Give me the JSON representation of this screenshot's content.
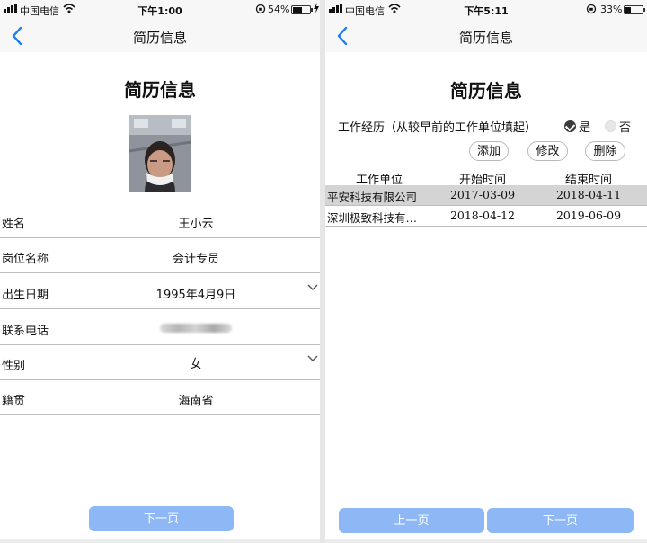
{
  "left": {
    "status": {
      "carrier": "中国电信",
      "time": "下午1:00",
      "battery": "54%",
      "battery_level": 0.54
    },
    "nav": {
      "title": "简历信息"
    },
    "heading": "简历信息",
    "fields": [
      {
        "label": "姓名",
        "value": "王小云",
        "dropdown": false
      },
      {
        "label": "岗位名称",
        "value": "会计专员",
        "dropdown": false
      },
      {
        "label": "出生日期",
        "value": "1995年4月9日",
        "dropdown": true
      },
      {
        "label": "联系电话",
        "value": "",
        "dropdown": false
      },
      {
        "label": "性别",
        "value": "女",
        "dropdown": true
      },
      {
        "label": "籍贯",
        "value": "海南省",
        "dropdown": false
      }
    ],
    "next_label": "下一页"
  },
  "right": {
    "status": {
      "carrier": "中国电信",
      "time": "下午5:11",
      "battery": "33%",
      "battery_level": 0.33
    },
    "nav": {
      "title": "简历信息"
    },
    "heading": "简历信息",
    "experience_label": "工作经历（从较早前的工作单位填起）",
    "yes_label": "是",
    "no_label": "否",
    "add_label": "添加",
    "edit_label": "修改",
    "delete_label": "删除",
    "table": {
      "headers": [
        "工作单位",
        "开始时间",
        "结束时间"
      ],
      "rows": [
        {
          "unit": "平安科技有限公司",
          "start": "2017-03-09",
          "end": "2018-04-11",
          "selected": true
        },
        {
          "unit": "深圳极致科技有…",
          "start": "2018-04-12",
          "end": "2019-06-09",
          "selected": false
        }
      ]
    },
    "prev_label": "上一页",
    "next_label": "下一页"
  },
  "colors": {
    "accent": "#1a7cf5",
    "button": "#8db8f5",
    "selected_row": "#d4d4d4"
  }
}
